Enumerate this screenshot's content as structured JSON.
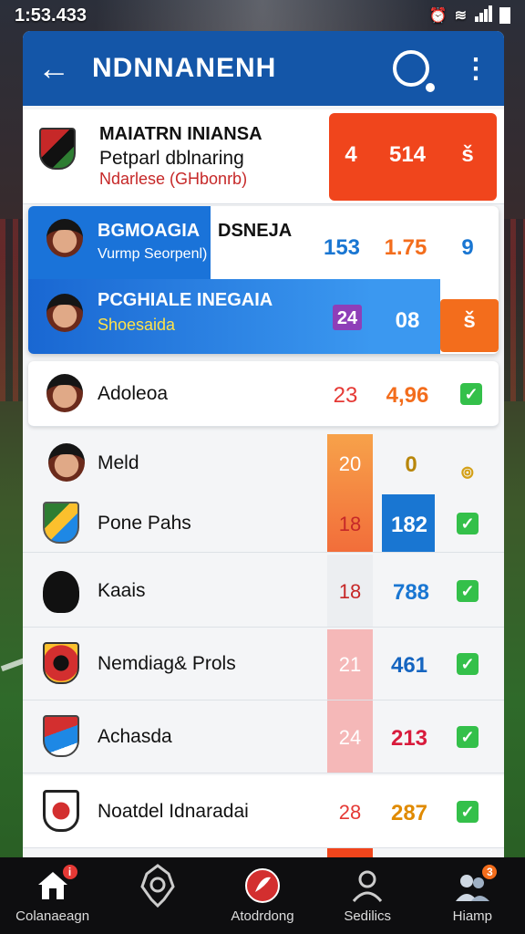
{
  "status": {
    "time": "1:53.433"
  },
  "header": {
    "back_icon": "arrow-left-icon",
    "title": "NDNNANENH"
  },
  "top_card": {
    "line1": "MAIATRN INIANSA",
    "line2": "Petparl dblnaring",
    "line3": "Ndarlese (GHbonrb)",
    "values": [
      "4",
      "514",
      "š"
    ],
    "accent": "#f0451c"
  },
  "highlight_rows": [
    {
      "name": "BGMOAGIA",
      "extra": "DSNEJA",
      "sub": "Vurmp Seorpenl)",
      "values": [
        "153",
        "1.75",
        "9"
      ]
    },
    {
      "name": "PCGHIALE INEGAIA",
      "sub": "Shoesaida",
      "values": [
        "24",
        "08",
        "š"
      ]
    }
  ],
  "rows": [
    {
      "name": "Adoleoa",
      "v1": "23",
      "v2": "4,96",
      "checked": true
    },
    {
      "name": "Meld",
      "v1": "20",
      "v2": "0",
      "mark": "๏"
    },
    {
      "name": "Pone Pahs",
      "v1": "18",
      "v2": "182",
      "checked": true
    },
    {
      "name": "Kaais",
      "v1": "18",
      "v2": "788",
      "checked": true
    },
    {
      "name": "Nemdiag& Prols",
      "v1": "21",
      "v2": "461",
      "checked": true
    },
    {
      "name": "Achasda",
      "v1": "24",
      "v2": "213",
      "checked": true
    },
    {
      "name": "Noatdel Idnaradai",
      "v1": "28",
      "v2": "287",
      "checked": true
    }
  ],
  "nav": [
    {
      "label": "Colanaeagn",
      "icon": "home-icon",
      "badge": "i"
    },
    {
      "label": "",
      "icon": "trophy-icon"
    },
    {
      "label": "Atodrdong",
      "icon": "ball-icon"
    },
    {
      "label": "Sedilics",
      "icon": "profile-icon"
    },
    {
      "label": "Hiamp",
      "icon": "people-icon",
      "badge": "3"
    }
  ]
}
